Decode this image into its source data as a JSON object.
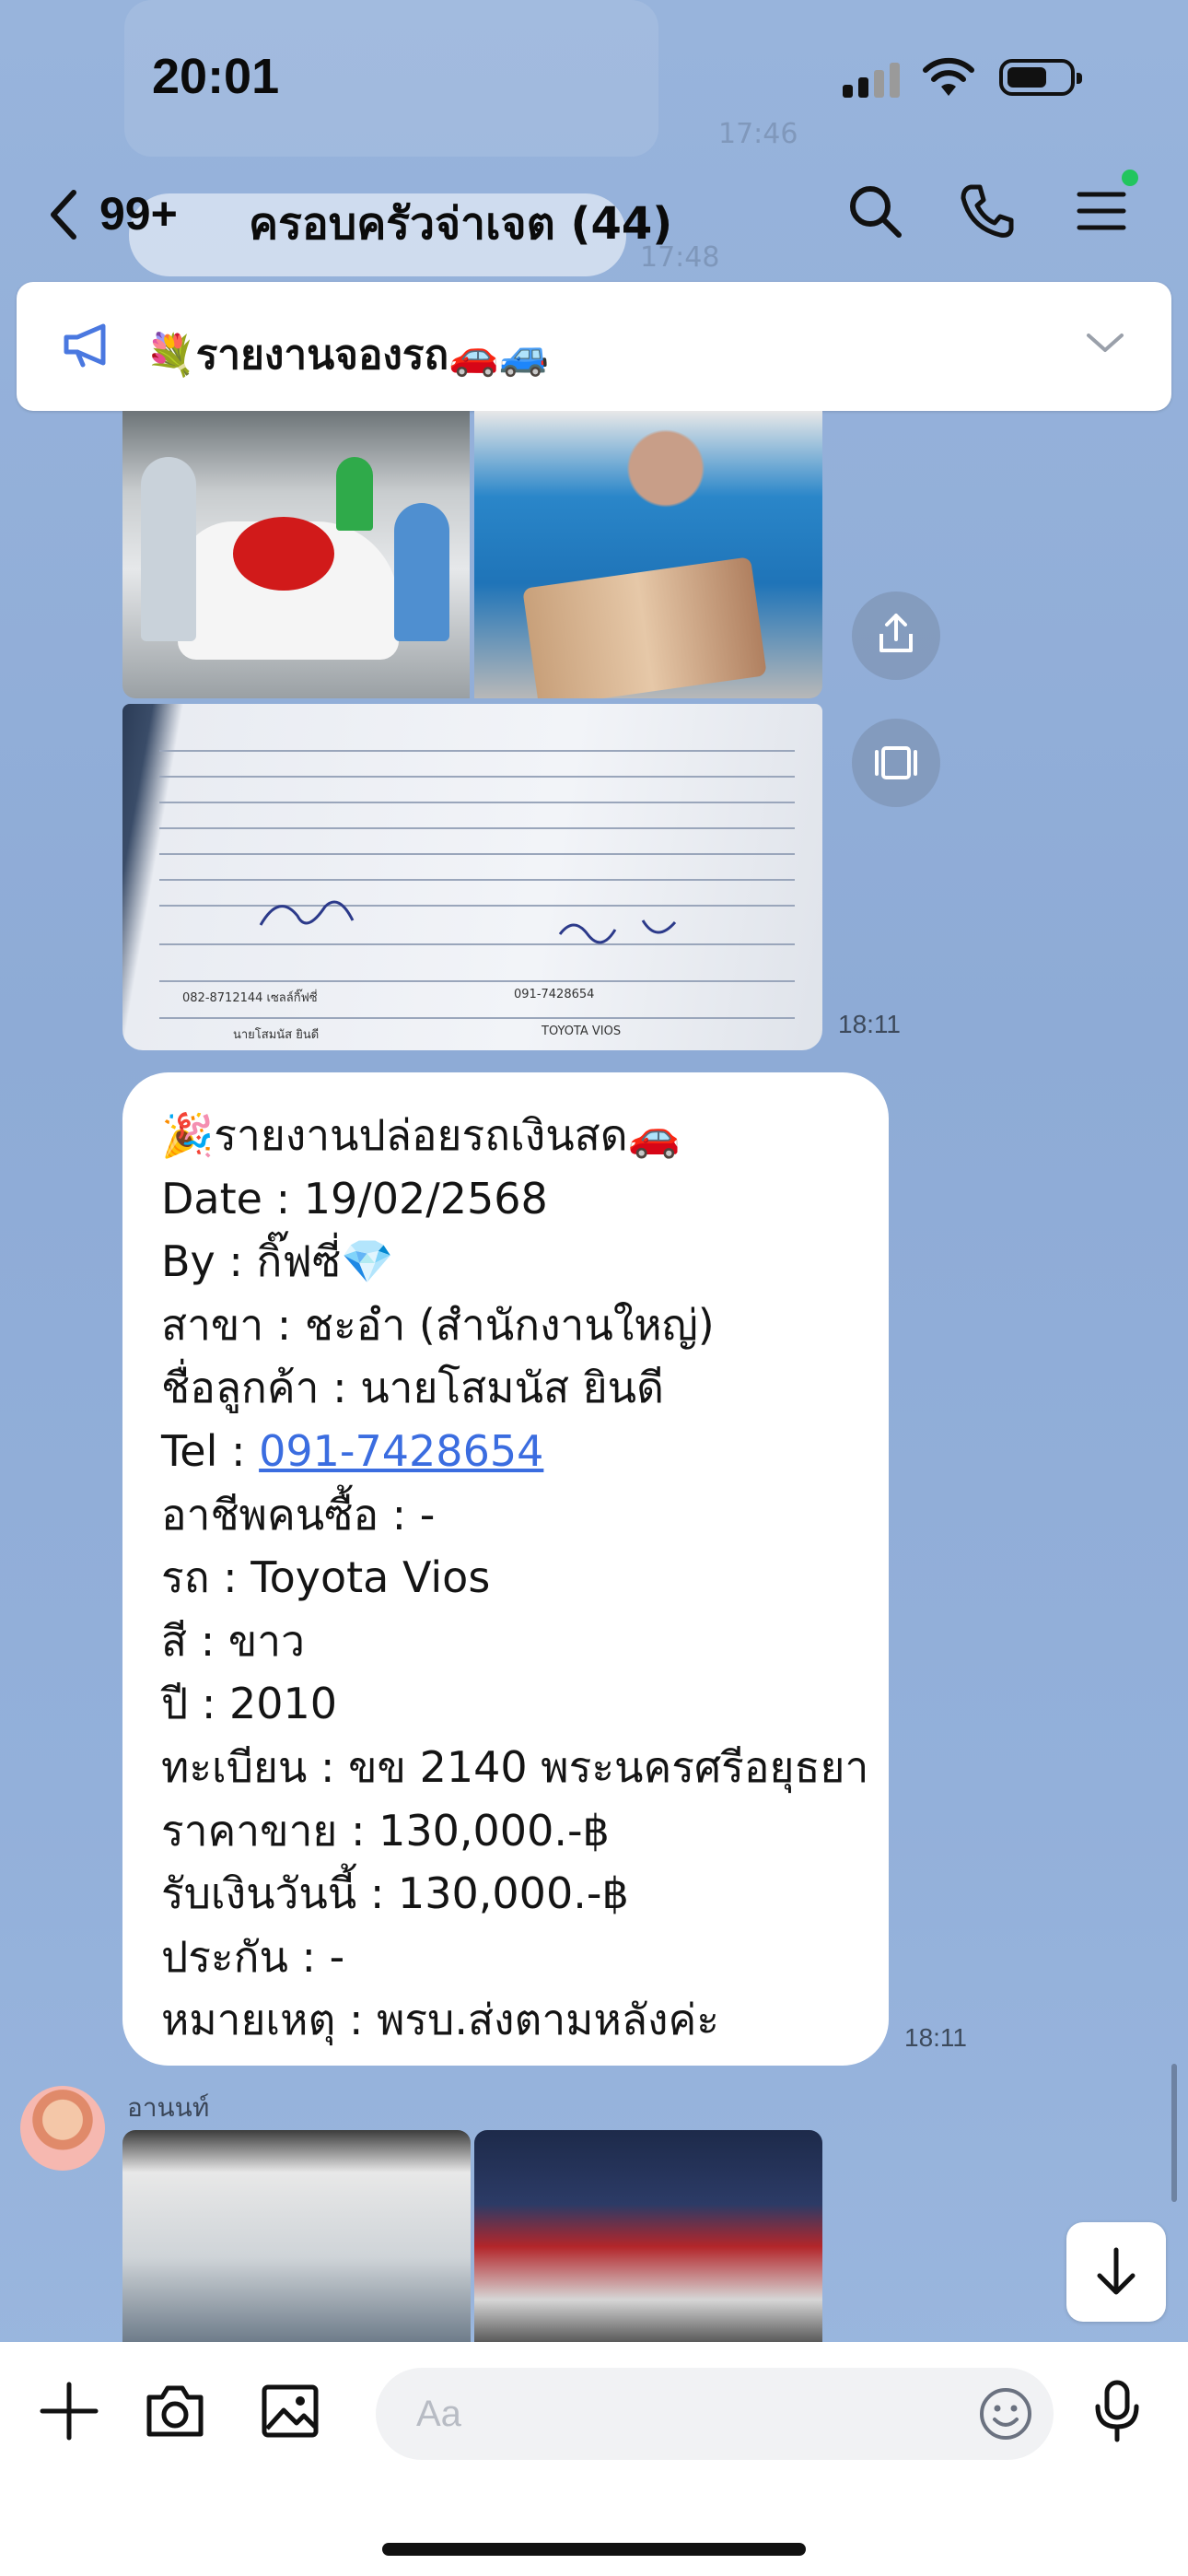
{
  "status_bar": {
    "time": "20:01"
  },
  "header": {
    "unread_count": "99+",
    "group_title": "ครอบครัวจ่าเจต (44)",
    "icons": [
      "back-icon",
      "search-icon",
      "phone-icon",
      "menu-icon"
    ]
  },
  "background_ghost": {
    "line1": "17:46",
    "line2": "17:48"
  },
  "announcement": {
    "text": "💐รายงานจองรถ🚗🚙",
    "icon": "megaphone-icon"
  },
  "timestamps": {
    "album": "18:11",
    "message": "18:11"
  },
  "document_photo": {
    "phone_buyer": "082-8712144 เซลล์กิ๊ฟซี่",
    "phone_seller": "091-7428654",
    "car": "TOYOTA VIOS",
    "buyer": "นายโสมนัส ยินดี"
  },
  "message": {
    "lines": [
      "🎉รายงานปล่อยรถเงินสด🚗",
      "Date : 19/02/2568",
      "By : กิ๊ฟซี่💎",
      "สาขา : ชะอำ (สำนักงานใหญ่)",
      "ชื่อลูกค้า : นายโสมนัส ยินดี"
    ],
    "tel_label": "Tel : ",
    "tel_value": "091-7428654",
    "lines_after": [
      "อาชีพคนซื้อ : -",
      "รถ : Toyota Vios",
      "สี : ขาว",
      "ปี : 2010",
      "ทะเบียน : ขข 2140 พระนครศรีอยุธยา",
      "ราคาขาย : 130,000.-฿",
      "รับเงินวันนี้ : 130,000.-฿",
      "ประกัน : -",
      "หมายเหตุ : พรบ.ส่งตามหลังค่ะ"
    ]
  },
  "next_sender": {
    "name": "อานนท์"
  },
  "input": {
    "placeholder": "Aa"
  },
  "colors": {
    "link": "#3b6de0",
    "chat_bg": "#8fadd8",
    "online_dot": "#22c55e"
  }
}
